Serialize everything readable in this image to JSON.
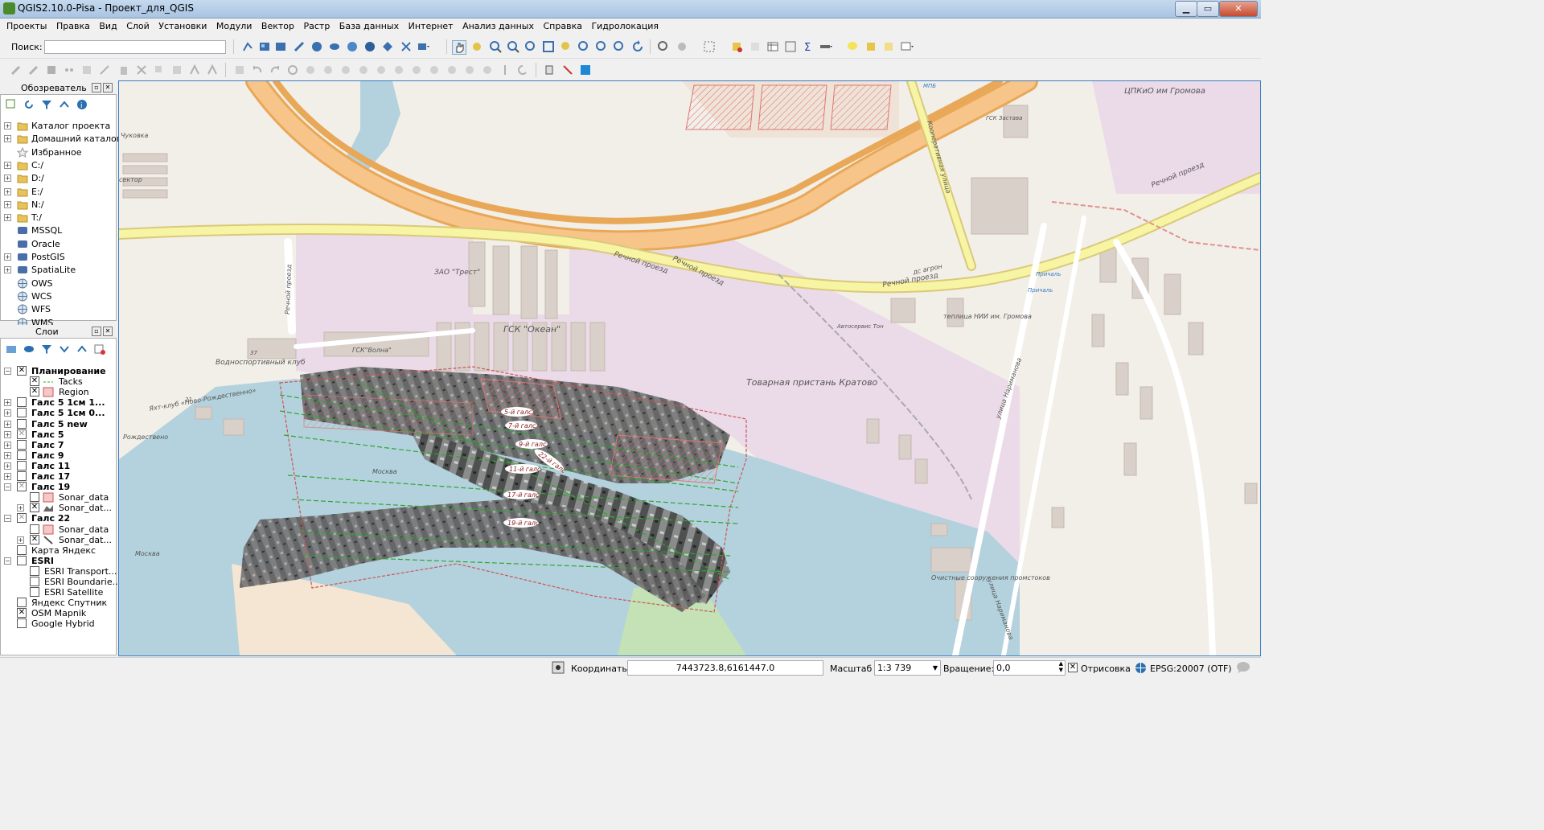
{
  "window": {
    "title": "QGIS2.10.0-Pisa - Проект_для_QGIS",
    "minimize": "▁",
    "maximize": "▭",
    "close": "✕"
  },
  "menu": [
    "Проекты",
    "Правка",
    "Вид",
    "Слой",
    "Установки",
    "Модули",
    "Вектор",
    "Растр",
    "База данных",
    "Интернет",
    "Анализ данных",
    "Справка",
    "Гидролокация"
  ],
  "search": {
    "label": "Поиск:",
    "value": ""
  },
  "browser_panel": {
    "title": "Обозреватель",
    "items": [
      {
        "label": "Каталог проекта",
        "icon": "folder-icon",
        "expand": true
      },
      {
        "label": "Домашний каталог",
        "icon": "folder-icon",
        "expand": true
      },
      {
        "label": "Избранное",
        "icon": "star-icon",
        "expand": false
      },
      {
        "label": "C:/",
        "icon": "folder-icon",
        "expand": true
      },
      {
        "label": "D:/",
        "icon": "folder-icon",
        "expand": true
      },
      {
        "label": "E:/",
        "icon": "folder-icon",
        "expand": true
      },
      {
        "label": "N:/",
        "icon": "folder-icon",
        "expand": true
      },
      {
        "label": "T:/",
        "icon": "folder-icon",
        "expand": true
      },
      {
        "label": "MSSQL",
        "icon": "mssql-icon",
        "expand": false
      },
      {
        "label": "Oracle",
        "icon": "oracle-icon",
        "expand": false
      },
      {
        "label": "PostGIS",
        "icon": "postgis-icon",
        "expand": true
      },
      {
        "label": "SpatiaLite",
        "icon": "spatialite-icon",
        "expand": true
      },
      {
        "label": "OWS",
        "icon": "globe-icon",
        "expand": false
      },
      {
        "label": "WCS",
        "icon": "globe-icon",
        "expand": false
      },
      {
        "label": "WFS",
        "icon": "globe-icon",
        "expand": false
      },
      {
        "label": "WMS",
        "icon": "globe-icon",
        "expand": false
      }
    ]
  },
  "layers_panel": {
    "title": "Слои",
    "items": [
      {
        "label": "Планирование",
        "bold": true,
        "checked": "x",
        "indent": 0,
        "expand": "−"
      },
      {
        "label": "Tacks",
        "bold": false,
        "checked": "x",
        "indent": 1,
        "expand": "",
        "icon": "line-symbol-icon"
      },
      {
        "label": "Region",
        "bold": false,
        "checked": "x",
        "indent": 1,
        "expand": "",
        "icon": "polygon-symbol-icon"
      },
      {
        "label": "Галс 5 1см 1...",
        "bold": true,
        "checked": "",
        "indent": 0,
        "expand": "+"
      },
      {
        "label": "Галс 5 1см 0...",
        "bold": true,
        "checked": "",
        "indent": 0,
        "expand": "+"
      },
      {
        "label": "Галс 5 new",
        "bold": true,
        "checked": "",
        "indent": 0,
        "expand": "+"
      },
      {
        "label": "Галс 5",
        "bold": true,
        "checked": "partial",
        "indent": 0,
        "expand": "+"
      },
      {
        "label": "Галс 7",
        "bold": true,
        "checked": "",
        "indent": 0,
        "expand": "+"
      },
      {
        "label": "Галс 9",
        "bold": true,
        "checked": "",
        "indent": 0,
        "expand": "+"
      },
      {
        "label": "Галс 11",
        "bold": true,
        "checked": "",
        "indent": 0,
        "expand": "+"
      },
      {
        "label": "Галс 17",
        "bold": true,
        "checked": "",
        "indent": 0,
        "expand": "+"
      },
      {
        "label": "Галс 19",
        "bold": true,
        "checked": "partial",
        "indent": 0,
        "expand": "−"
      },
      {
        "label": "Sonar_data",
        "bold": false,
        "checked": "",
        "indent": 1,
        "expand": "",
        "icon": "polygon-symbol-icon"
      },
      {
        "label": "Sonar_dat...",
        "bold": false,
        "checked": "x",
        "indent": 1,
        "expand": "+",
        "icon": "raster-icon"
      },
      {
        "label": "Галс 22",
        "bold": true,
        "checked": "partial",
        "indent": 0,
        "expand": "−"
      },
      {
        "label": "Sonar_data",
        "bold": false,
        "checked": "",
        "indent": 1,
        "expand": "",
        "icon": "polygon-symbol-icon"
      },
      {
        "label": "Sonar_dat...",
        "bold": false,
        "checked": "x",
        "indent": 1,
        "expand": "+",
        "icon": "line-layer-icon"
      },
      {
        "label": "Карта Яндекс",
        "bold": false,
        "checked": "",
        "indent": 0,
        "expand": ""
      },
      {
        "label": "ESRI",
        "bold": true,
        "checked": "",
        "indent": 0,
        "expand": "−"
      },
      {
        "label": "ESRI Transport...",
        "bold": false,
        "checked": "",
        "indent": 1,
        "expand": ""
      },
      {
        "label": "ESRI Boundarie...",
        "bold": false,
        "checked": "",
        "indent": 1,
        "expand": ""
      },
      {
        "label": "ESRI Satellite",
        "bold": false,
        "checked": "",
        "indent": 1,
        "expand": ""
      },
      {
        "label": "Яндекс Спутник",
        "bold": false,
        "checked": "",
        "indent": 0,
        "expand": ""
      },
      {
        "label": "OSM Mapnik",
        "bold": false,
        "checked": "x",
        "indent": 0,
        "expand": ""
      },
      {
        "label": "Google Hybrid",
        "bold": false,
        "checked": "",
        "indent": 0,
        "expand": ""
      }
    ]
  },
  "map": {
    "labels": {
      "river_prospect_1": "Речной проезд",
      "river_prospect_2": "Речной проезд",
      "river_prospect_3": "Речной проезд",
      "river_prospect_4": "Речной проезд",
      "river_prospect_vert": "Речной проезд",
      "kooperativnaya": "Кооперативная улица",
      "narimanova": "улица Нариманова",
      "narimanova2": "улица Нариманова",
      "zao_trest": "ЗАО \"Трест\"",
      "gsk_okean": "ГСК \"Океан\"",
      "gsk_volna": "ГСК\"Волна\"",
      "vodno_sport_club": "Водноспортивный клуб",
      "yacht_club": "Яхт-клуб «Ново-Рождественно»",
      "rozhdestveno": "Рождествено",
      "tovarnaya": "Товарная пристань Кратово",
      "teplitsa": "теплица НИИ им. Громова",
      "ochistnye": "Очистные сооружения промстоков",
      "park_gromova": "ЦПКиО им Громова",
      "moskva_river": "Москва",
      "moskva_river2": "Москва",
      "prichan": "Причаль",
      "prichan2": "Причаль",
      "num_37": "37",
      "num_21": "21",
      "ds_agron": "дс агрон",
      "sector": "сектор",
      "chukovka": "Чуковка",
      "gsk_zastava": "ГСК Застава",
      "mpb": "МПБ",
      "auto_service": "Автосервис Тон"
    },
    "tacks": [
      {
        "label": "5-й галс"
      },
      {
        "label": "7-й галс"
      },
      {
        "label": "9-й галс"
      },
      {
        "label": "22-й галс"
      },
      {
        "label": "11-й галс"
      },
      {
        "label": "17-й галс"
      },
      {
        "label": "19-й галс"
      }
    ]
  },
  "status": {
    "coords_label": "Координаты:",
    "coords_value": "7443723.8,6161447.0",
    "scale_label": "Масштаб",
    "scale_value": "1:3 739",
    "rotation_label": "Вращение:",
    "rotation_value": "0,0",
    "render_label": "Отрисовка",
    "epsg": "EPSG:20007 (OTF)"
  }
}
